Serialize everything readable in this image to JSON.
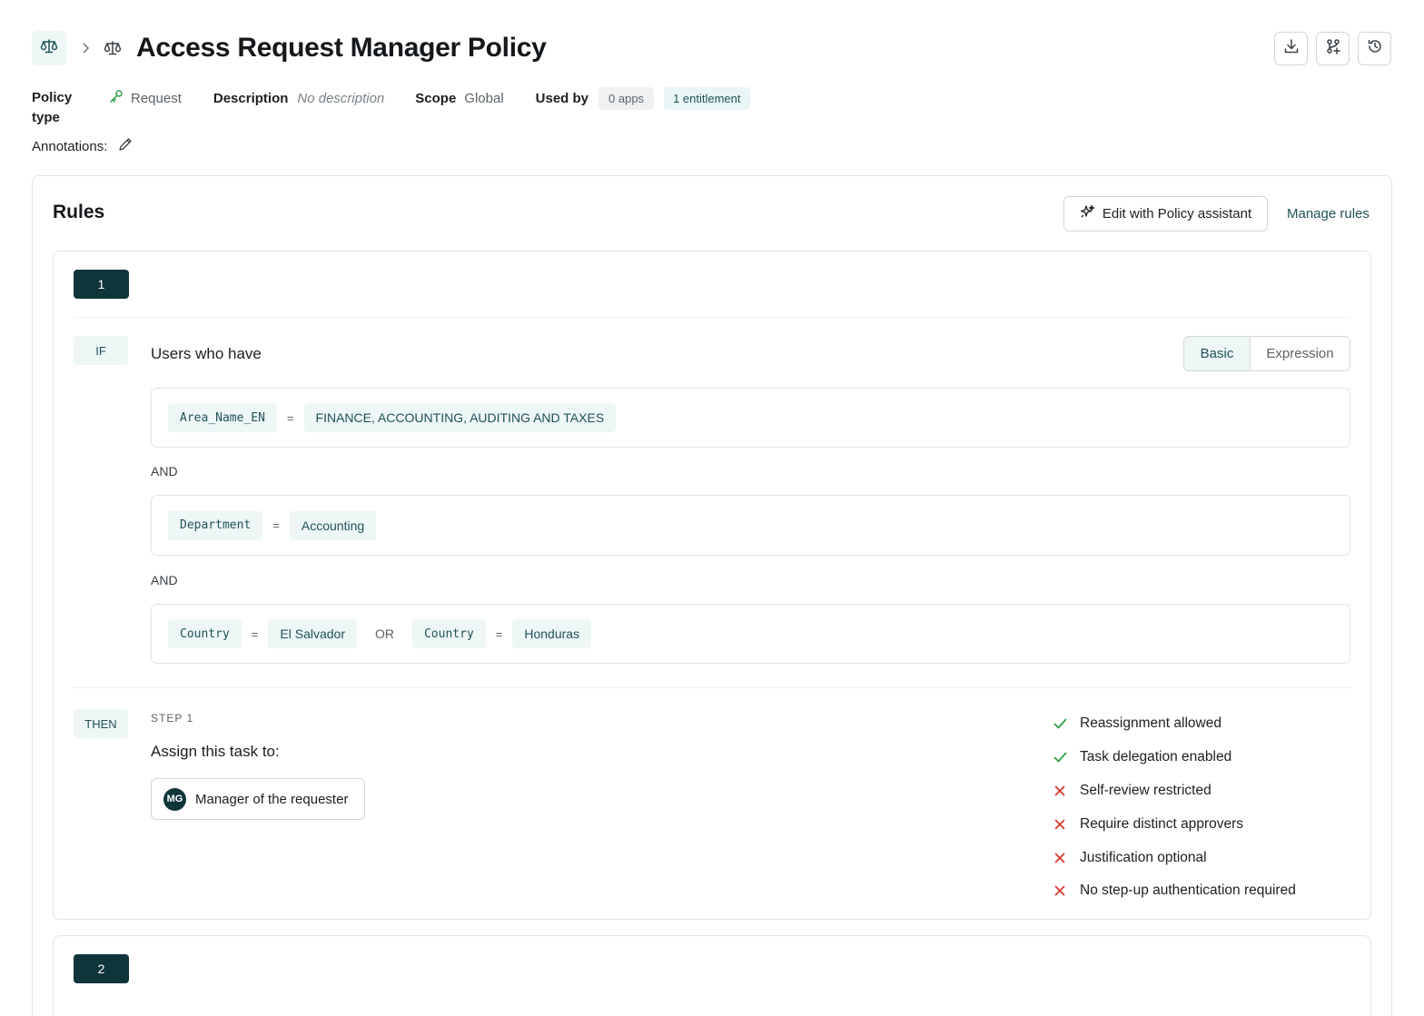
{
  "header": {
    "title": "Access Request Manager Policy",
    "breadcrumb_icon": "scale-icon",
    "actions": [
      {
        "name": "download-icon"
      },
      {
        "name": "branch-add-icon"
      },
      {
        "name": "history-icon"
      }
    ]
  },
  "meta": {
    "policy_type_label": "Policy type",
    "policy_type_value": "Request",
    "description_label": "Description",
    "description_value": "No description",
    "scope_label": "Scope",
    "scope_value": "Global",
    "used_by_label": "Used by",
    "apps_chip": "0 apps",
    "entitlement_chip": "1 entitlement",
    "annotations_label": "Annotations:"
  },
  "colors": {
    "accent": "#1f5257",
    "dark_teal": "#0f343a",
    "chip_bg": "#eef6f6",
    "success": "#2e9e47",
    "danger": "#d6362b"
  },
  "rules": {
    "title": "Rules",
    "assistant_button": "Edit with Policy assistant",
    "manage_link": "Manage rules",
    "rule1": {
      "number": "1",
      "if_label": "IF",
      "users_who_have": "Users who have",
      "mode_basic": "Basic",
      "mode_expression": "Expression",
      "and_label": "AND",
      "conditions": [
        {
          "attr": "Area_Name_EN",
          "op": "=",
          "value": "FINANCE, ACCOUNTING, AUDITING AND TAXES"
        },
        {
          "attr": "Department",
          "op": "=",
          "value": "Accounting"
        },
        {
          "attr": "Country",
          "op": "=",
          "value": "El Salvador",
          "or": "OR",
          "attr2": "Country",
          "op2": "=",
          "value2": "Honduras"
        }
      ],
      "then_label": "THEN",
      "step_label": "STEP 1",
      "assign_label": "Assign this task to:",
      "assignee_initials": "MG",
      "assignee": "Manager of the requester",
      "settings": [
        {
          "label": "Reassignment allowed",
          "state": "check"
        },
        {
          "label": "Task delegation enabled",
          "state": "check"
        },
        {
          "label": "Self-review restricted",
          "state": "cross"
        },
        {
          "label": "Require distinct approvers",
          "state": "cross"
        },
        {
          "label": "Justification optional",
          "state": "cross"
        },
        {
          "label": "No step-up authentication required",
          "state": "cross"
        }
      ]
    },
    "rule2": {
      "number": "2"
    }
  }
}
